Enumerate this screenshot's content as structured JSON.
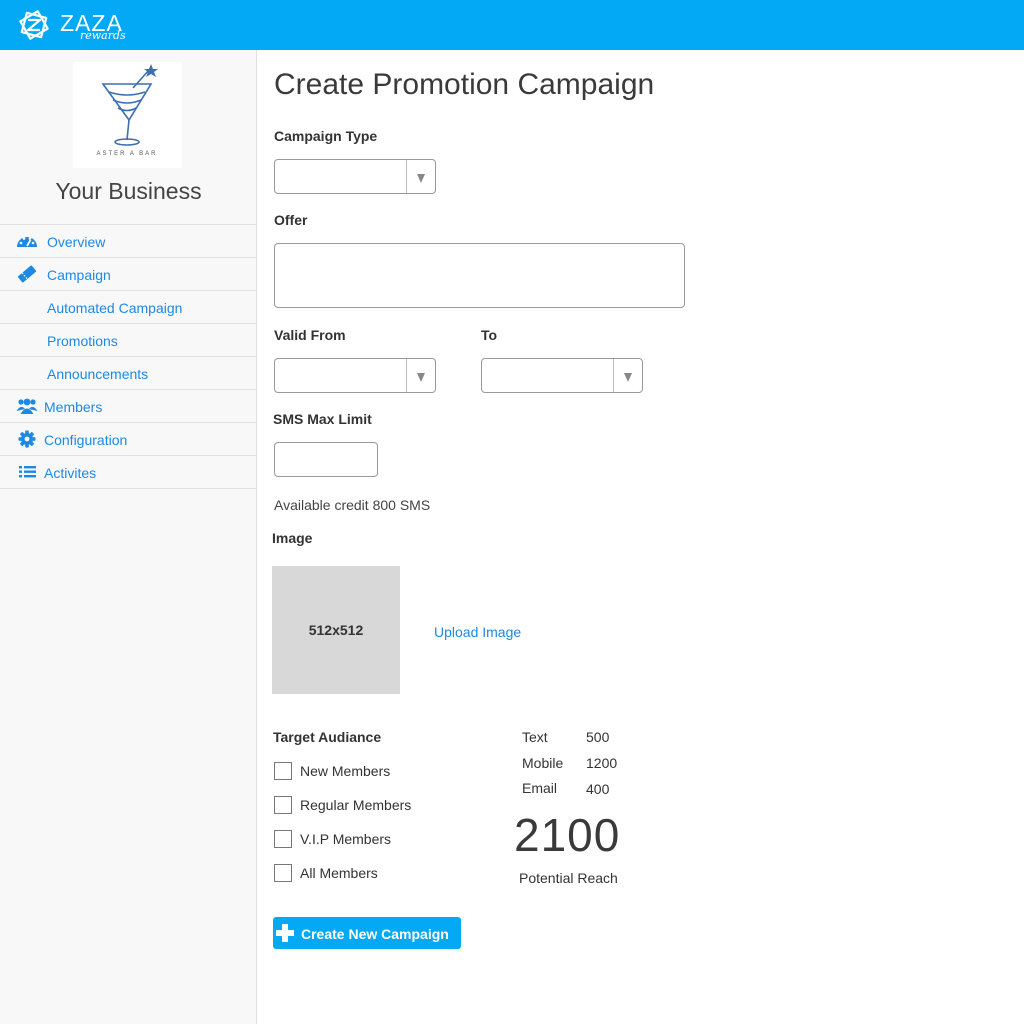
{
  "header": {
    "brand_name": "ZAZA",
    "brand_sub": "rewards"
  },
  "sidebar": {
    "logo_text": "ASTER A BAR",
    "business_name": "Your Business",
    "items": [
      {
        "label": "Overview",
        "icon": "dashboard-icon"
      },
      {
        "label": "Campaign",
        "icon": "ticket-icon"
      },
      {
        "label": "Automated Campaign"
      },
      {
        "label": "Promotions"
      },
      {
        "label": "Announcements"
      },
      {
        "label": "Members",
        "icon": "users-icon"
      },
      {
        "label": "Configuration",
        "icon": "gear-icon"
      },
      {
        "label": "Activites",
        "icon": "list-icon"
      }
    ]
  },
  "main": {
    "title": "Create Promotion Campaign",
    "campaign_type_label": "Campaign Type",
    "campaign_type_value": "",
    "offer_label": "Offer",
    "offer_value": "",
    "valid_from_label": "Valid From",
    "valid_from_value": "",
    "to_label": "To",
    "to_value": "",
    "sms_label": "SMS Max Limit",
    "sms_value": "",
    "credit_text": "Available credit 800 SMS",
    "image_label": "Image",
    "image_placeholder": "512x512",
    "upload_label": "Upload Image",
    "target_label": "Target Audiance",
    "audiences": [
      {
        "label": "New Members",
        "checked": false
      },
      {
        "label": "Regular Members",
        "checked": false
      },
      {
        "label": "V.I.P Members",
        "checked": false
      },
      {
        "label": "All Members",
        "checked": false
      }
    ],
    "stats": [
      {
        "label": "Text",
        "value": "500"
      },
      {
        "label": "Mobile",
        "value": "1200"
      },
      {
        "label": "Email",
        "value": "400"
      }
    ],
    "reach_number": "2100",
    "reach_label": "Potential Reach",
    "create_button": "Create New Campaign"
  },
  "colors": {
    "accent": "#03a9f4",
    "link": "#1e88e5"
  }
}
